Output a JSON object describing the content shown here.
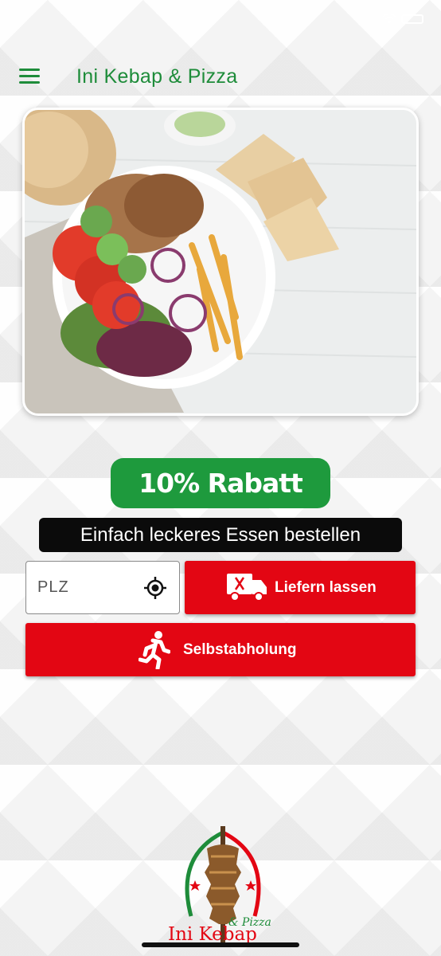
{
  "header": {
    "title": "Ini Kebap & Pizza",
    "menu_icon": "hamburger-menu-icon"
  },
  "hero": {
    "image": "doner-plate-photo"
  },
  "promo": {
    "discount": "10% Rabatt",
    "tagline": "Einfach leckeres Essen bestellen"
  },
  "order": {
    "plz_placeholder": "PLZ",
    "plz_value": "",
    "locate_icon": "crosshair-location-icon",
    "delivery_label": "Liefern lassen",
    "delivery_icon": "delivery-truck-icon",
    "pickup_label": "Selbstabholung",
    "pickup_icon": "running-person-icon"
  },
  "brand": {
    "logo_name": "Ini Kebap",
    "logo_sub": "& Pizza"
  },
  "colors": {
    "brand_green": "#1e8c3a",
    "badge_green": "#1e9a3d",
    "action_red": "#e30613",
    "tagline_bg": "#0b0b0b"
  }
}
